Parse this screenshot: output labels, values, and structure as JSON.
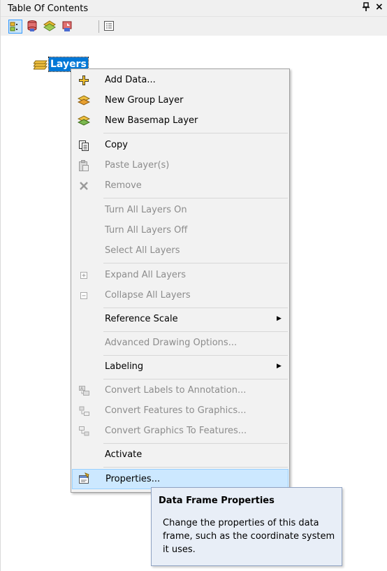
{
  "window": {
    "title": "Table Of Contents",
    "pin_glyph": "ᵖ",
    "close_glyph": "×"
  },
  "toolbar": {
    "buttons": [
      {
        "name": "list-by-drawing-order-icon"
      },
      {
        "name": "list-by-source-icon"
      },
      {
        "name": "list-by-visibility-icon"
      },
      {
        "name": "list-by-selection-icon"
      },
      {
        "name": "options-icon"
      }
    ]
  },
  "tree": {
    "root_label": "Layers"
  },
  "context_menu": {
    "items": [
      {
        "label": "Add Data...",
        "icon": "add-data-icon",
        "enabled": true
      },
      {
        "label": "New Group Layer",
        "icon": "group-layer-icon",
        "enabled": true
      },
      {
        "label": "New Basemap Layer",
        "icon": "basemap-layer-icon",
        "enabled": true
      },
      {
        "label": "Copy",
        "icon": "copy-icon",
        "enabled": true
      },
      {
        "label": "Paste Layer(s)",
        "icon": "paste-icon",
        "enabled": false
      },
      {
        "label": "Remove",
        "icon": "remove-icon",
        "enabled": false
      },
      {
        "label": "Turn All Layers On",
        "enabled": false
      },
      {
        "label": "Turn All Layers Off",
        "enabled": false
      },
      {
        "label": "Select All Layers",
        "enabled": false
      },
      {
        "label": "Expand All Layers",
        "icon": "expand-icon",
        "enabled": false
      },
      {
        "label": "Collapse All Layers",
        "icon": "collapse-icon",
        "enabled": false
      },
      {
        "label": "Reference Scale",
        "enabled": true,
        "submenu": true
      },
      {
        "label": "Advanced Drawing Options...",
        "enabled": false
      },
      {
        "label": "Labeling",
        "enabled": true,
        "submenu": true
      },
      {
        "label": "Convert Labels to Annotation...",
        "icon": "convert-labels-icon",
        "enabled": false
      },
      {
        "label": "Convert Features to Graphics...",
        "icon": "convert-features-icon",
        "enabled": false
      },
      {
        "label": "Convert Graphics To Features...",
        "icon": "convert-graphics-icon",
        "enabled": false
      },
      {
        "label": "Activate",
        "enabled": true
      },
      {
        "label": "Properties...",
        "icon": "properties-icon",
        "enabled": true,
        "highlighted": true
      }
    ]
  },
  "tooltip": {
    "title": "Data Frame Properties",
    "body": "Change the properties of this data frame, such as the coordinate system it uses."
  },
  "colors": {
    "selection_blue": "#0078d7",
    "menu_background": "#f2f2f2",
    "highlight_background": "#cce8ff",
    "disabled_text": "#8c8c8c",
    "tooltip_background": "#e8eef7"
  }
}
